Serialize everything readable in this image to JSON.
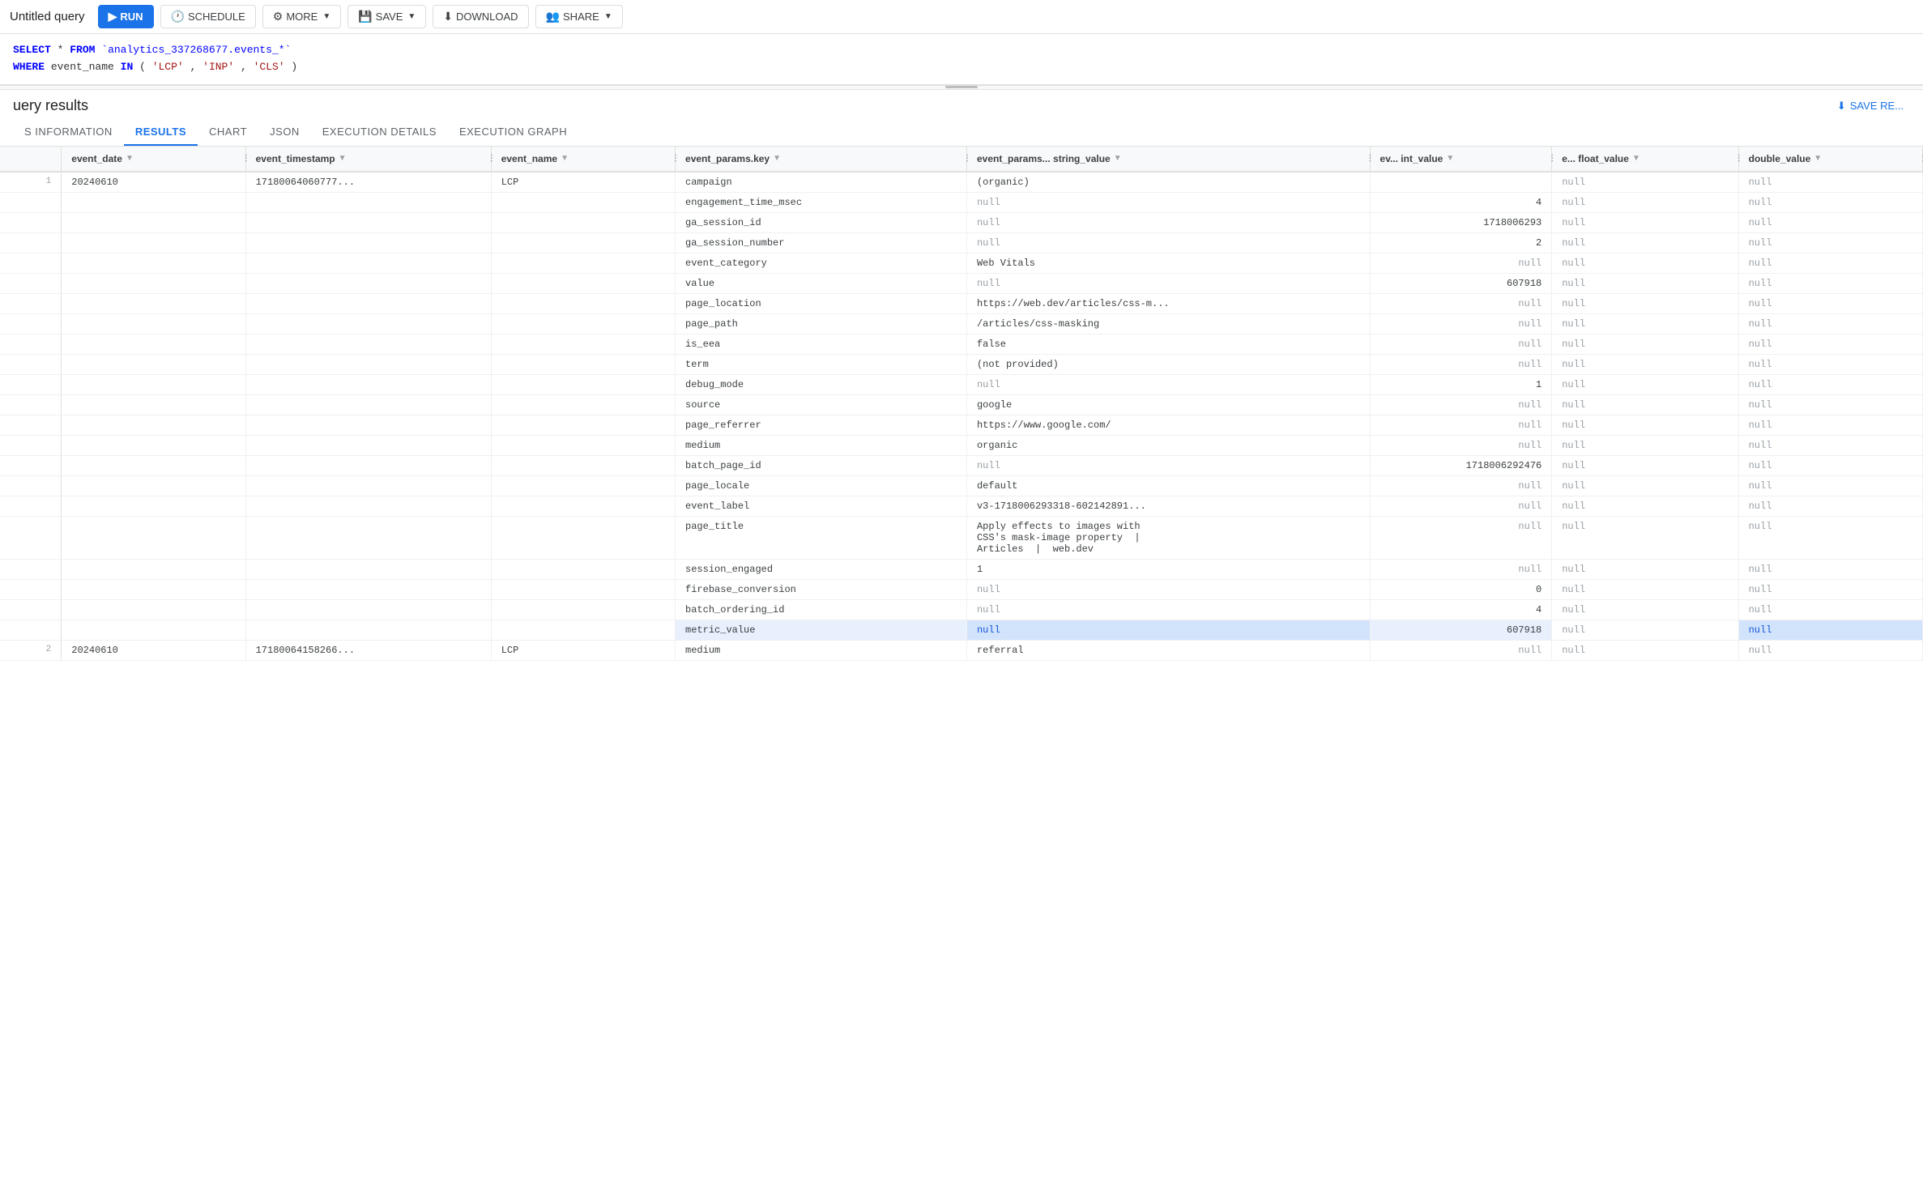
{
  "toolbar": {
    "title": "Untitled query",
    "run_label": "RUN",
    "schedule_label": "SCHEDULE",
    "more_label": "MORE",
    "save_label": "SAVE",
    "download_label": "DOWNLOAD",
    "share_label": "SHARE"
  },
  "sql": {
    "line1": "SELECT * FROM `analytics_337268677.events_*`",
    "line2": "WHERE event_name IN ('LCP', 'INP', 'CLS')"
  },
  "results": {
    "title": "uery results",
    "save_label": "SAVE RE..."
  },
  "tabs": [
    {
      "id": "schema",
      "label": "S INFORMATION"
    },
    {
      "id": "results",
      "label": "RESULTS",
      "active": true
    },
    {
      "id": "chart",
      "label": "CHART"
    },
    {
      "id": "json",
      "label": "JSON"
    },
    {
      "id": "execution-details",
      "label": "EXECUTION DETAILS"
    },
    {
      "id": "execution-graph",
      "label": "EXECUTION GRAPH"
    }
  ],
  "columns": [
    {
      "id": "num",
      "label": ""
    },
    {
      "id": "event_date",
      "label": "event_date"
    },
    {
      "id": "event_timestamp",
      "label": "event_timestamp"
    },
    {
      "id": "event_name",
      "label": "event_name"
    },
    {
      "id": "params_key",
      "label": "event_params.key"
    },
    {
      "id": "params_string",
      "label": "event_params... string_value"
    },
    {
      "id": "ev_int",
      "label": "ev... int_value"
    },
    {
      "id": "ev_float",
      "label": "e... float_value"
    },
    {
      "id": "double_value",
      "label": "double_value"
    }
  ],
  "rows": [
    {
      "row_num": "1",
      "event_date": "20240610",
      "event_timestamp": "17180064060777...",
      "event_name": "LCP",
      "params": [
        {
          "key": "campaign",
          "string_value": "(organic)",
          "int_value": "",
          "float_value": "",
          "double_value": ""
        },
        {
          "key": "engagement_time_msec",
          "string_value": "null",
          "int_value": "4",
          "float_value": "",
          "double_value": ""
        },
        {
          "key": "ga_session_id",
          "string_value": "null",
          "int_value": "1718006293",
          "float_value": "",
          "double_value": ""
        },
        {
          "key": "ga_session_number",
          "string_value": "null",
          "int_value": "2",
          "float_value": "",
          "double_value": ""
        },
        {
          "key": "event_category",
          "string_value": "Web Vitals",
          "int_value": "null",
          "float_value": "",
          "double_value": ""
        },
        {
          "key": "value",
          "string_value": "null",
          "int_value": "607918",
          "float_value": "",
          "double_value": ""
        },
        {
          "key": "page_location",
          "string_value": "https://web.dev/articles/css-m...",
          "int_value": "null",
          "float_value": "",
          "double_value": ""
        },
        {
          "key": "page_path",
          "string_value": "/articles/css-masking",
          "int_value": "null",
          "float_value": "",
          "double_value": ""
        },
        {
          "key": "is_eea",
          "string_value": "false",
          "int_value": "null",
          "float_value": "",
          "double_value": ""
        },
        {
          "key": "term",
          "string_value": "(not provided)",
          "int_value": "null",
          "float_value": "",
          "double_value": ""
        },
        {
          "key": "debug_mode",
          "string_value": "null",
          "int_value": "1",
          "float_value": "",
          "double_value": ""
        },
        {
          "key": "source",
          "string_value": "google",
          "int_value": "null",
          "float_value": "",
          "double_value": ""
        },
        {
          "key": "page_referrer",
          "string_value": "https://www.google.com/",
          "int_value": "null",
          "float_value": "",
          "double_value": ""
        },
        {
          "key": "medium",
          "string_value": "organic",
          "int_value": "null",
          "float_value": "",
          "double_value": ""
        },
        {
          "key": "batch_page_id",
          "string_value": "null",
          "int_value": "1718006292476",
          "float_value": "",
          "double_value": ""
        },
        {
          "key": "page_locale",
          "string_value": "default",
          "int_value": "null",
          "float_value": "",
          "double_value": ""
        },
        {
          "key": "event_label",
          "string_value": "v3-1718006293318-602142891...",
          "int_value": "null",
          "float_value": "",
          "double_value": ""
        },
        {
          "key": "page_title",
          "string_value": "Apply effects to images with\nCSS's mask-image property  |\nArticles  |  web.dev",
          "int_value": "null",
          "float_value": "",
          "double_value": ""
        },
        {
          "key": "session_engaged",
          "string_value": "1",
          "int_value": "null",
          "float_value": "",
          "double_value": ""
        },
        {
          "key": "firebase_conversion",
          "string_value": "null",
          "int_value": "0",
          "float_value": "",
          "double_value": ""
        },
        {
          "key": "batch_ordering_id",
          "string_value": "null",
          "int_value": "4",
          "float_value": "",
          "double_value": ""
        },
        {
          "key": "metric_value",
          "string_value": "null",
          "int_value": "607918",
          "float_value": "",
          "double_value": "",
          "highlight": true
        }
      ]
    },
    {
      "row_num": "2",
      "event_date": "20240610",
      "event_timestamp": "17180064158266...",
      "event_name": "LCP",
      "params": [
        {
          "key": "medium",
          "string_value": "referral",
          "int_value": "null",
          "float_value": "",
          "double_value": ""
        }
      ]
    }
  ]
}
